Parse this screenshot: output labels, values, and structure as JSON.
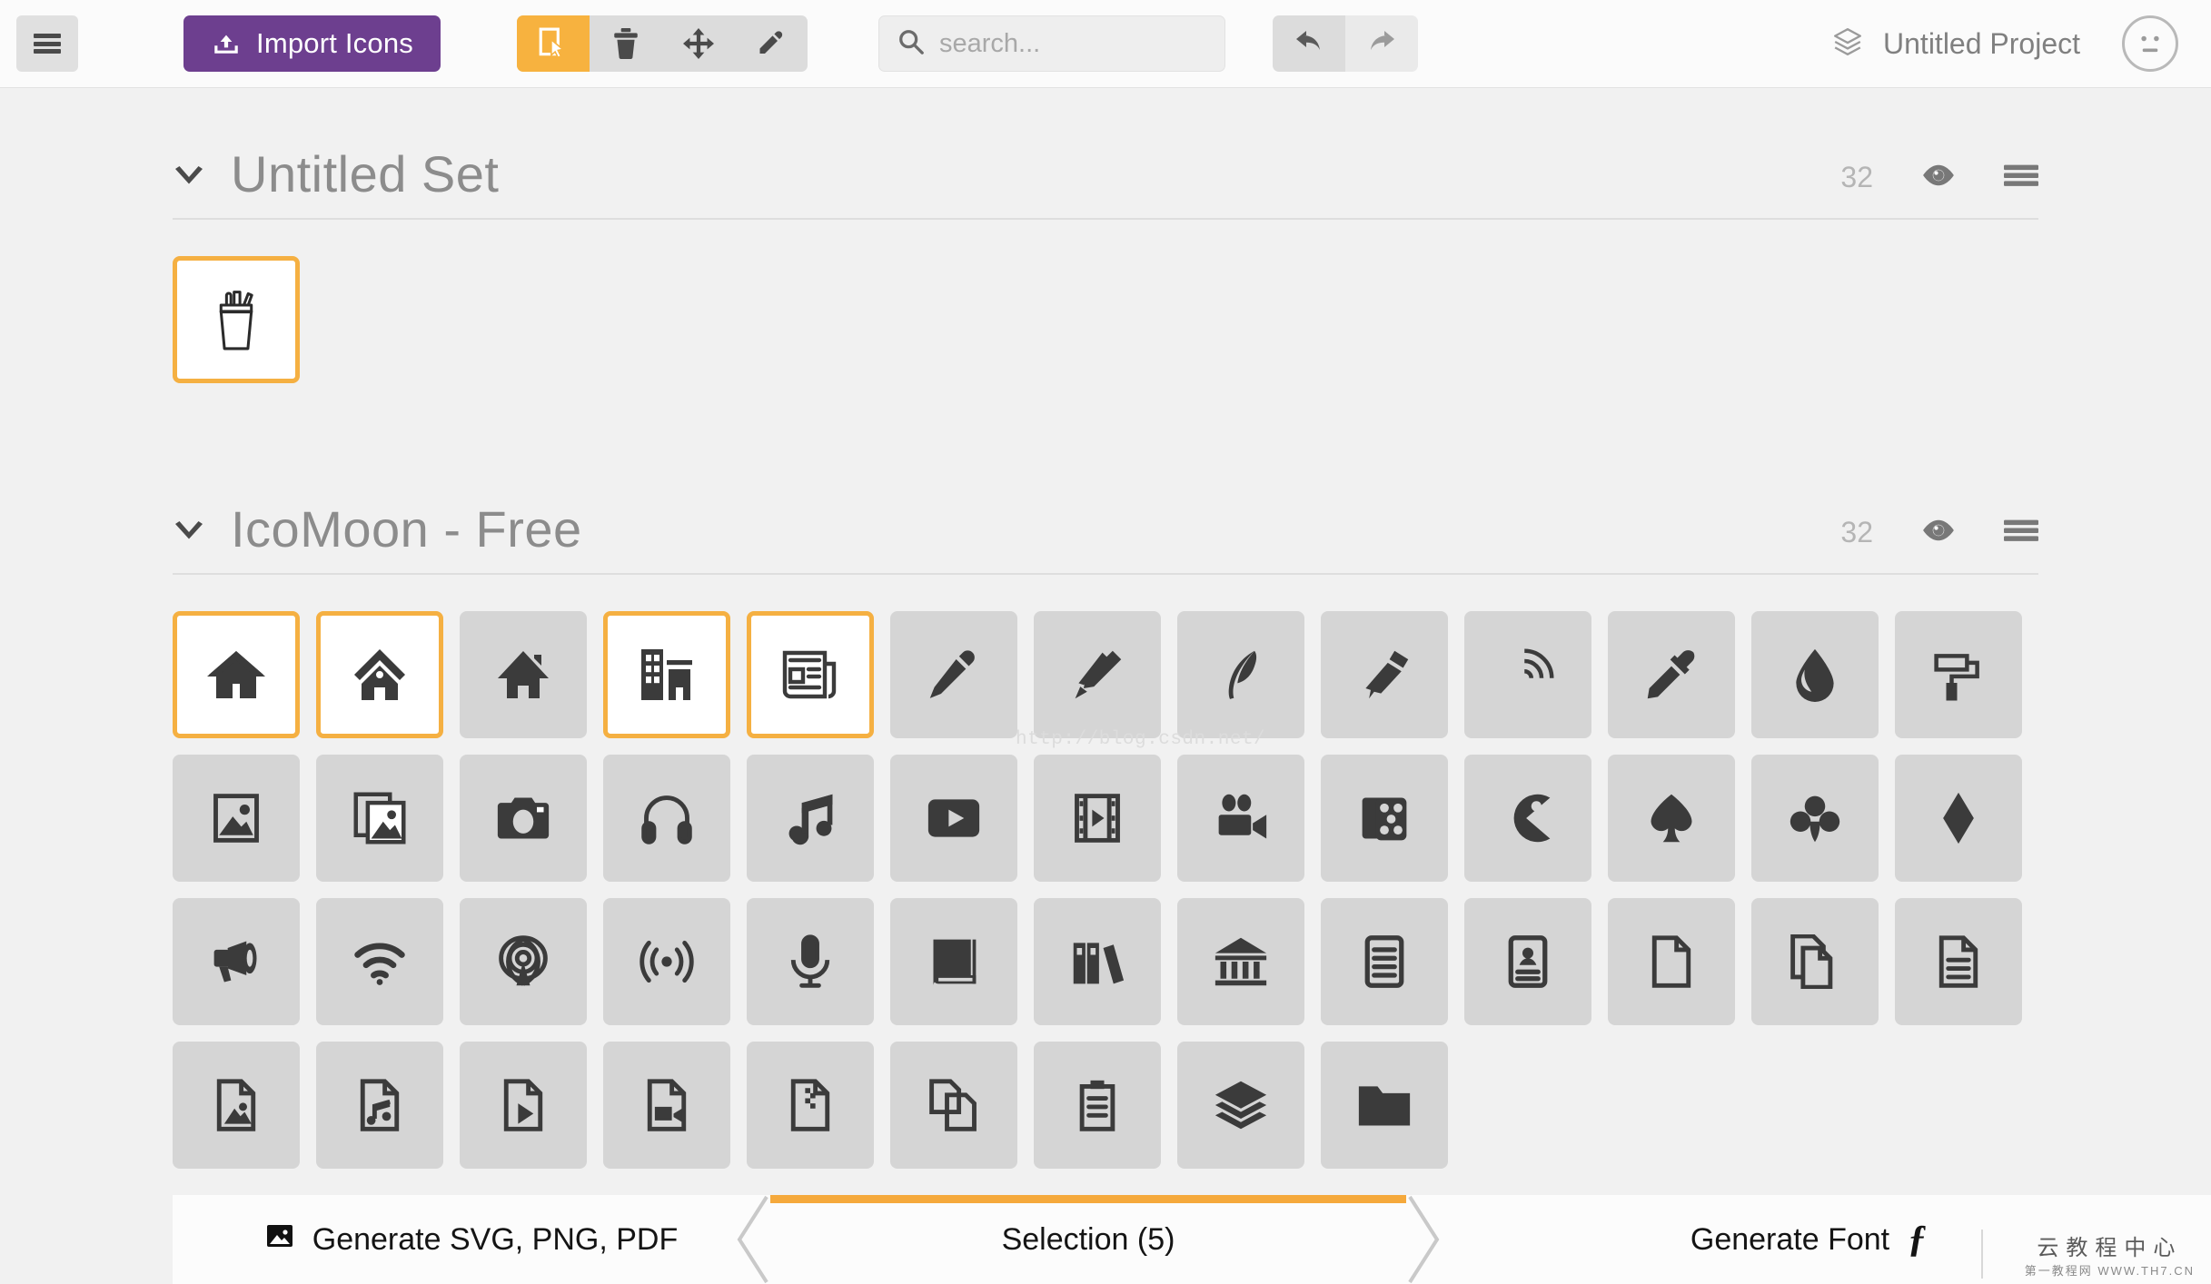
{
  "header": {
    "menu_button_label": "menu",
    "import": {
      "label": "Import Icons",
      "color": "#6d3f8f"
    },
    "tools": [
      {
        "name": "select",
        "title": "Select",
        "active": true
      },
      {
        "name": "delete",
        "title": "Delete",
        "active": false
      },
      {
        "name": "move",
        "title": "Move",
        "active": false
      },
      {
        "name": "edit",
        "title": "Edit",
        "active": false
      }
    ],
    "search": {
      "value": "",
      "placeholder": "search..."
    },
    "history": [
      {
        "name": "undo",
        "title": "Undo"
      },
      {
        "name": "redo",
        "title": "Redo"
      }
    ],
    "project": {
      "name": "Untitled Project",
      "icon": "layers-icon"
    },
    "avatar": {
      "icon": "neutral-face-icon"
    }
  },
  "sets": [
    {
      "title": "Untitled Set",
      "count": "32",
      "expanded": true,
      "eye_icon": "eye-icon",
      "menu_icon": "hamburger-icon",
      "icons": [
        {
          "name": "pencil-cup-icon",
          "selected": true
        }
      ]
    },
    {
      "title": "IcoMoon - Free",
      "count": "32",
      "expanded": true,
      "eye_icon": "eye-icon",
      "menu_icon": "hamburger-icon",
      "icons": [
        {
          "name": "home-icon",
          "selected": true
        },
        {
          "name": "home2-icon",
          "selected": true
        },
        {
          "name": "home3-icon",
          "selected": false
        },
        {
          "name": "office-icon",
          "selected": true
        },
        {
          "name": "newspaper-icon",
          "selected": true
        },
        {
          "name": "pencil-icon",
          "selected": false
        },
        {
          "name": "pencil2-icon",
          "selected": false
        },
        {
          "name": "quill-icon",
          "selected": false
        },
        {
          "name": "pen-icon",
          "selected": false
        },
        {
          "name": "blog-icon",
          "selected": false
        },
        {
          "name": "eyedropper-icon",
          "selected": false
        },
        {
          "name": "droplet-icon",
          "selected": false
        },
        {
          "name": "paint-format-icon",
          "selected": false
        },
        {
          "name": "image-icon",
          "selected": false
        },
        {
          "name": "images-icon",
          "selected": false
        },
        {
          "name": "camera-icon",
          "selected": false
        },
        {
          "name": "headphones-icon",
          "selected": false
        },
        {
          "name": "music-icon",
          "selected": false
        },
        {
          "name": "play-icon",
          "selected": false
        },
        {
          "name": "film-icon",
          "selected": false
        },
        {
          "name": "video-camera-icon",
          "selected": false
        },
        {
          "name": "dice-icon",
          "selected": false
        },
        {
          "name": "pacman-icon",
          "selected": false
        },
        {
          "name": "spades-icon",
          "selected": false
        },
        {
          "name": "clubs-icon",
          "selected": false
        },
        {
          "name": "diamonds-icon",
          "selected": false
        },
        {
          "name": "bullhorn-icon",
          "selected": false
        },
        {
          "name": "connection-icon",
          "selected": false
        },
        {
          "name": "podcast-icon",
          "selected": false
        },
        {
          "name": "feed-icon",
          "selected": false
        },
        {
          "name": "mic-icon",
          "selected": false
        },
        {
          "name": "book-icon",
          "selected": false
        },
        {
          "name": "books-icon",
          "selected": false
        },
        {
          "name": "library-icon",
          "selected": false
        },
        {
          "name": "file-text-icon",
          "selected": false
        },
        {
          "name": "profile-icon",
          "selected": false
        },
        {
          "name": "file-empty-icon",
          "selected": false
        },
        {
          "name": "files-empty-icon",
          "selected": false
        },
        {
          "name": "file-text2-icon",
          "selected": false
        },
        {
          "name": "file-picture-icon",
          "selected": false
        },
        {
          "name": "file-music-icon",
          "selected": false
        },
        {
          "name": "file-play-icon",
          "selected": false
        },
        {
          "name": "file-video-icon",
          "selected": false
        },
        {
          "name": "file-zip-icon",
          "selected": false
        },
        {
          "name": "copy-icon",
          "selected": false
        },
        {
          "name": "paste-icon",
          "selected": false
        },
        {
          "name": "stack-icon",
          "selected": false
        },
        {
          "name": "folder-icon",
          "selected": false
        }
      ]
    }
  ],
  "bottom_bar": {
    "generate_assets_label": "Generate SVG, PNG, PDF",
    "generate_assets_icon": "image-icon",
    "selection_label": "Selection (5)",
    "generate_font_label": "Generate Font",
    "generate_font_glyph": "ƒ",
    "active_tab": "selection",
    "accent_color": "#f5a93c"
  },
  "watermarks": {
    "top": "http://blog.csdn.net/",
    "bottom_cn": "云教程中心",
    "bottom_sub": "第一教程网   WWW.TH7.CN"
  }
}
